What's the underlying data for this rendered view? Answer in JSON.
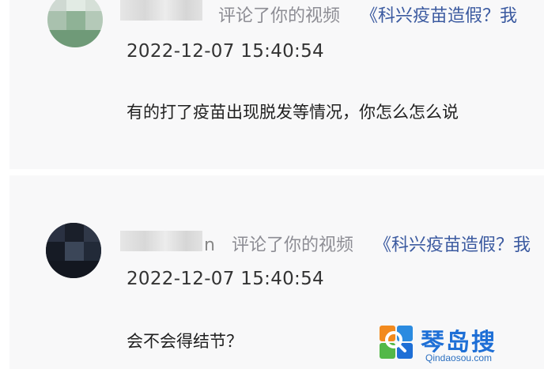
{
  "comments": [
    {
      "user_suffix": "",
      "action": "评论了你的视频",
      "video_link": "《科兴疫苗造假？我",
      "timestamp": "2022-12-07 15:40:54",
      "text": "有的打了疫苗出现脱发等情况，你怎么怎么说"
    },
    {
      "user_suffix": "n",
      "action": "评论了你的视频",
      "video_link": "《科兴疫苗造假？我",
      "timestamp": "2022-12-07 15:40:54",
      "text": "会不会得结节？"
    }
  ],
  "watermark": {
    "title": "琴岛搜",
    "subtitle": "Qindaosou.com"
  },
  "colors": {
    "panel": "#f8f8f9",
    "link": "#3b5aa0",
    "meta": "#8d8d94",
    "watermark": "#1e6fd6"
  }
}
